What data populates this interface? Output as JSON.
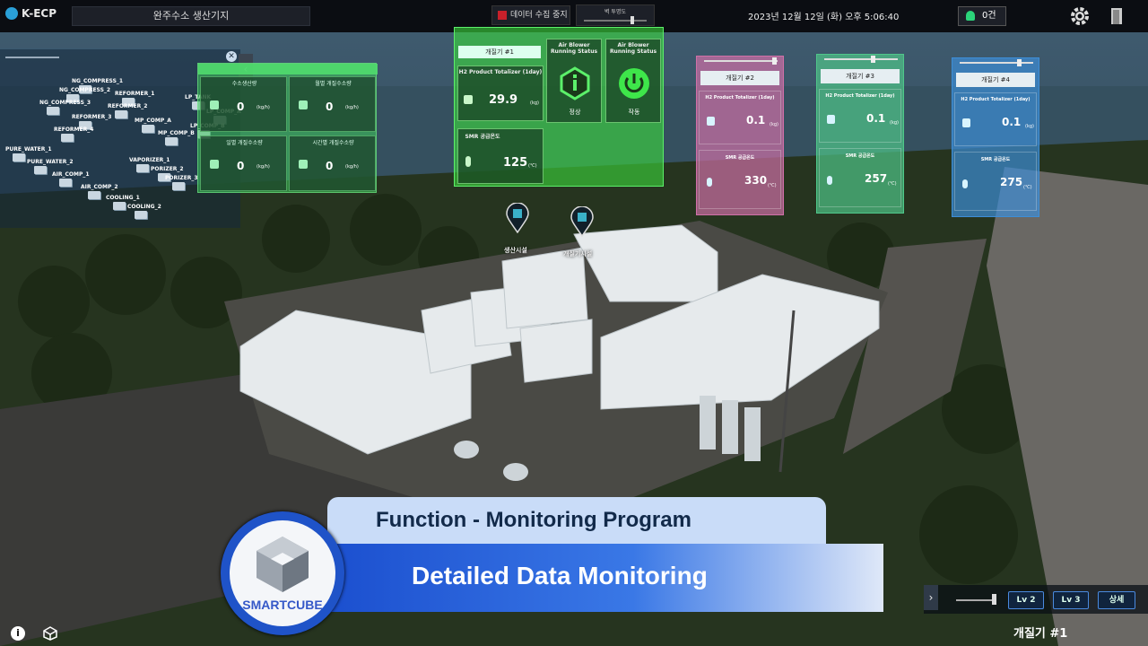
{
  "topbar": {
    "logo": "K-ECP",
    "site": "완주수소 생산기지",
    "collect_label": "데이터 수집 중지",
    "opacity_label": "벽 투명도",
    "datetime": "2023년 12월 12일 (화)  오후 5:06:40",
    "alarm_count": "0건"
  },
  "sidebar": {
    "nodes": [
      "NG_COMPRESS_1",
      "NG_COMPRESS_2",
      "NG_COMPRESS_3",
      "REFORMER_1",
      "REFORMER_2",
      "REFORMER_3",
      "REFORMER_4",
      "LP_TANK",
      "MP_COMP_A",
      "LP_COMP_A",
      "MP_COMP_B",
      "LP_COMP_B",
      "PURE_WATER_1",
      "PURE_WATER_2",
      "VAPORIZER_1",
      "PORIZER_2",
      "PORIZER_3",
      "AIR_COMP_1",
      "AIR_COMP_2",
      "COOLING_1",
      "COOLING_2"
    ]
  },
  "site_panel": {
    "cells": [
      {
        "label": "수소생산량",
        "value": "0",
        "unit": "(kg/h)"
      },
      {
        "label": "월별 개질수소량",
        "value": "0",
        "unit": "(kg/h)"
      },
      {
        "label": "일별 개질수소량",
        "value": "0",
        "unit": "(kg/h)"
      },
      {
        "label": "시간별 개질수소량",
        "value": "0",
        "unit": "(kg/h)"
      }
    ]
  },
  "gen1": {
    "title": "개질기 #1",
    "h2_label": "H2 Product Totalizer (1day)",
    "h2_value": "29.9",
    "h2_unit": "(kg)",
    "smr_label": "SMR 공급온도",
    "smr_value": "125",
    "smr_unit": "(℃)",
    "blower1_label": "Air Blower Running Status",
    "blower1_state": "정상",
    "blower2_label": "Air Blower Running Status",
    "blower2_state": "작동"
  },
  "generators": [
    {
      "title": "개질기 #2",
      "h2_label": "H2 Product Totalizer (1day)",
      "h2_value": "0.1",
      "h2_unit": "(kg)",
      "smr_label": "SMR 공급온도",
      "smr_value": "330",
      "smr_unit": "(℃)",
      "color": "#d070a8"
    },
    {
      "title": "개질기 #3",
      "h2_label": "H2 Product Totalizer (1day)",
      "h2_value": "0.1",
      "h2_unit": "(kg)",
      "smr_label": "SMR 공급온도",
      "smr_value": "257",
      "smr_unit": "(℃)",
      "color": "#4fc78a"
    },
    {
      "title": "개질기 #4",
      "h2_label": "H2 Product Totalizer (1day)",
      "h2_value": "0.1",
      "h2_unit": "(kg)",
      "smr_label": "SMR 공급온도",
      "smr_value": "275",
      "smr_unit": "(℃)",
      "color": "#3d8ed8"
    }
  ],
  "markers": [
    {
      "label": "생산시설"
    },
    {
      "label": "개질기시설"
    }
  ],
  "banner": {
    "title": "Function - Monitoring Program",
    "subtitle": "Detailed Data Monitoring",
    "brand": "SMARTCUBE"
  },
  "bottom": {
    "lv2": "Lv 2",
    "lv3": "Lv 3",
    "detail": "상세",
    "current": "개질기 #1"
  },
  "colors": {
    "accent_green": "#4fe860",
    "banner_blue": "#1b4fcf",
    "pink": "#d070a8",
    "blue": "#3d8ed8"
  }
}
